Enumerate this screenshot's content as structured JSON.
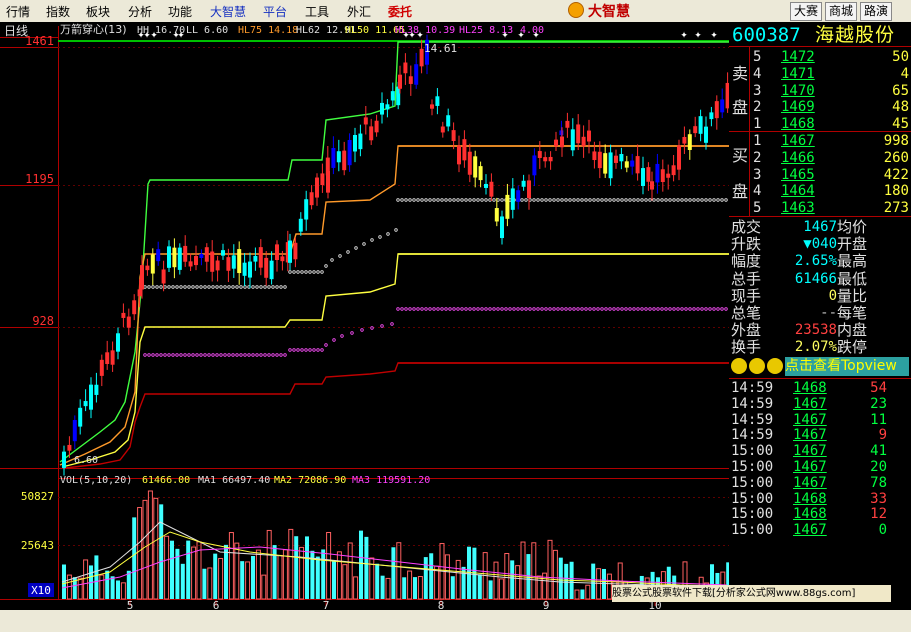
{
  "menu": {
    "items": [
      "行情",
      "指数",
      "板块",
      "分析",
      "功能",
      "大智慧",
      "平台",
      "工具",
      "外汇",
      "委托"
    ],
    "brand": "大智慧",
    "right_buttons": [
      "大赛",
      "商城",
      "路演"
    ]
  },
  "chart": {
    "period_label": "日线",
    "indicator_line": {
      "name": "万箭穿心(13)",
      "pairs": [
        {
          "label": "HH",
          "value": "16.70",
          "color": "#e0e0e0"
        },
        {
          "label": "LL",
          "value": "6.60",
          "color": "#e0e0e0"
        },
        {
          "label": "HL75",
          "value": "14.18",
          "color": "#ff9a2a"
        },
        {
          "label": "HL62",
          "value": "12.91",
          "color": "#e0e0e0"
        },
        {
          "label": "HL50",
          "value": "11.65",
          "color": "#ffff40"
        },
        {
          "label": "HL38",
          "value": "10.39",
          "color": "#ff40ff"
        },
        {
          "label": "HL25",
          "value": "8.13",
          "color": "#ff40ff"
        },
        {
          "label": "",
          "value": "4.00",
          "color": "#ff40ff"
        }
      ]
    },
    "price_axis": [
      "1461",
      "1195",
      "928"
    ],
    "peak_label": "14.61",
    "low_label": "6.60",
    "volume": {
      "name": "VOL(5,10,20)",
      "value": "61466.00",
      "ma1_label": "MA1",
      "ma1_value": "66497.40",
      "ma2_label": "MA2",
      "ma2_value": "72086.90",
      "ma3_label": "MA3",
      "ma3_value": "119591.20",
      "axis": [
        "50827",
        "25643"
      ],
      "scale_label": "X10"
    },
    "date_axis": [
      "5",
      "6",
      "7",
      "8",
      "9",
      "10"
    ]
  },
  "quote": {
    "code": "600387",
    "name": "海越股份",
    "sell_label": [
      "卖",
      "盘"
    ],
    "buy_label": [
      "买",
      "盘"
    ],
    "asks": [
      {
        "level": "5",
        "price": "1472",
        "vol": "50"
      },
      {
        "level": "4",
        "price": "1471",
        "vol": "4"
      },
      {
        "level": "3",
        "price": "1470",
        "vol": "65"
      },
      {
        "level": "2",
        "price": "1469",
        "vol": "48"
      },
      {
        "level": "1",
        "price": "1468",
        "vol": "45"
      }
    ],
    "bids": [
      {
        "level": "1",
        "price": "1467",
        "vol": "998"
      },
      {
        "level": "2",
        "price": "1466",
        "vol": "260"
      },
      {
        "level": "3",
        "price": "1465",
        "vol": "422"
      },
      {
        "level": "4",
        "price": "1464",
        "vol": "180"
      },
      {
        "level": "5",
        "price": "1463",
        "vol": "273"
      }
    ],
    "stats": [
      {
        "label": "成交",
        "value": "1467",
        "label2": "均价",
        "vcolor": "#00ffff"
      },
      {
        "label": "升跌",
        "value": "▼040",
        "label2": "开盘",
        "vcolor": "#00ffff"
      },
      {
        "label": "幅度",
        "value": "2.65%",
        "label2": "最高",
        "vcolor": "#00ffff"
      },
      {
        "label": "总手",
        "value": "61466",
        "label2": "最低",
        "vcolor": "#00ffff"
      },
      {
        "label": "现手",
        "value": "0",
        "label2": "量比",
        "vcolor": "#ffff60"
      },
      {
        "label": "总笔",
        "value": "--",
        "label2": "每笔",
        "vcolor": "#c0c0c0"
      },
      {
        "label": "外盘",
        "value": "23538",
        "label2": "内盘",
        "vcolor": "#ff4040"
      },
      {
        "label": "换手",
        "value": "2.07%",
        "label2": "跌停",
        "vcolor": "#ffff60"
      }
    ],
    "promo": "点击查看Topview",
    "ticks": [
      {
        "time": "14:59",
        "price": "1468",
        "vol": "54",
        "vcolor": "#ff4040"
      },
      {
        "time": "14:59",
        "price": "1467",
        "vol": "23",
        "vcolor": "#00ff40"
      },
      {
        "time": "14:59",
        "price": "1467",
        "vol": "11",
        "vcolor": "#00ff40"
      },
      {
        "time": "14:59",
        "price": "1467",
        "vol": "9",
        "vcolor": "#ff4040"
      },
      {
        "time": "15:00",
        "price": "1467",
        "vol": "41",
        "vcolor": "#00ff40"
      },
      {
        "time": "15:00",
        "price": "1467",
        "vol": "20",
        "vcolor": "#00ff40"
      },
      {
        "time": "15:00",
        "price": "1467",
        "vol": "78",
        "vcolor": "#00ff40"
      },
      {
        "time": "15:00",
        "price": "1468",
        "vol": "33",
        "vcolor": "#ff4040"
      },
      {
        "time": "15:00",
        "price": "1468",
        "vol": "12",
        "vcolor": "#ff4040"
      },
      {
        "time": "15:00",
        "price": "1467",
        "vol": "0",
        "vcolor": "#00ff40"
      }
    ]
  },
  "footer": {
    "banner": "股票公式股票软件下载[分析家公式网www.88gs.com]"
  }
}
